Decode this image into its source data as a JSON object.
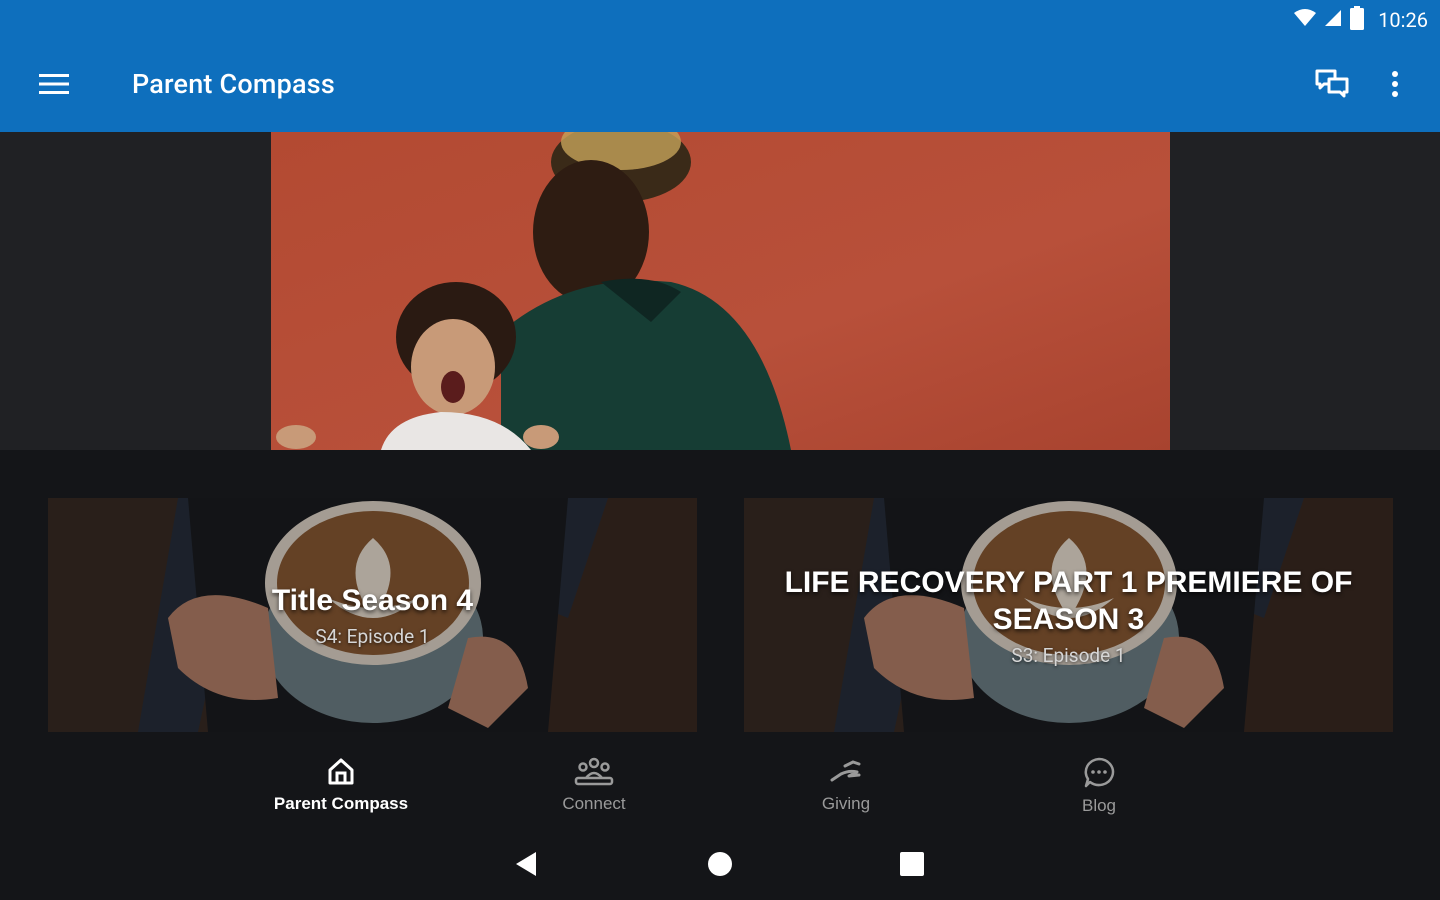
{
  "status_bar": {
    "time": "10:26",
    "icons": [
      "wifi-icon",
      "cell-signal-icon",
      "battery-icon"
    ]
  },
  "app_bar": {
    "title": "Parent Compass",
    "left_icon": "menu-icon",
    "right_icons": [
      "chat-icon",
      "more-vert-icon"
    ]
  },
  "hero": {
    "image": "parent-holding-child-photo"
  },
  "cards": [
    {
      "title": "Title Season 4",
      "subtitle": "S4: Episode 1"
    },
    {
      "title": "LIFE RECOVERY PART 1  PREMIERE OF SEASON 3",
      "subtitle": "S3: Episode 1"
    }
  ],
  "bottom_nav": {
    "items": [
      {
        "label": "Parent Compass",
        "icon": "home-icon",
        "active": true
      },
      {
        "label": "Connect",
        "icon": "people-icon",
        "active": false
      },
      {
        "label": "Giving",
        "icon": "giving-hand-icon",
        "active": false
      },
      {
        "label": "Blog",
        "icon": "chat-bubble-icon",
        "active": false
      }
    ]
  },
  "system_nav": [
    "back-icon",
    "home-circle-icon",
    "recents-icon"
  ],
  "colors": {
    "primary": "#0e6fbd",
    "background": "#141518",
    "active_nav": "#ffffff",
    "inactive_nav": "#9a9a9a"
  }
}
